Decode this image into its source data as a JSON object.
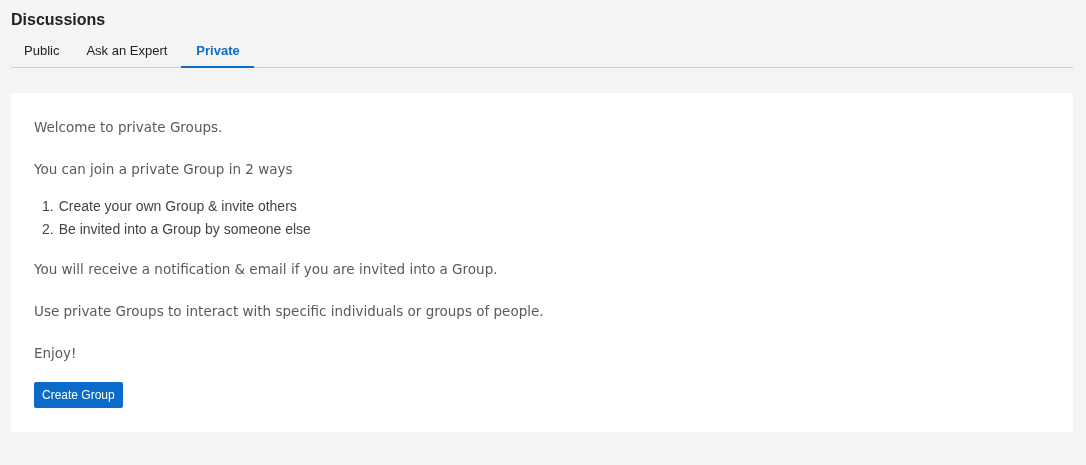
{
  "title": "Discussions",
  "tabs": [
    {
      "label": "Public",
      "selected": false
    },
    {
      "label": "Ask an Expert",
      "selected": false
    },
    {
      "label": "Private",
      "selected": true
    }
  ],
  "intro": [
    "Welcome to private Groups.",
    "You can join a private Group in 2 ways"
  ],
  "steps": [
    {
      "number": "1.",
      "text": "Create your own Group & invite others"
    },
    {
      "number": "2.",
      "text": "Be invited into a Group by someone else"
    }
  ],
  "outro": [
    "You will receive a notification & email if you are invited into a Group.",
    "Use private Groups to interact with specific individuals or groups of people.",
    "Enjoy!"
  ],
  "button": "Create Group"
}
